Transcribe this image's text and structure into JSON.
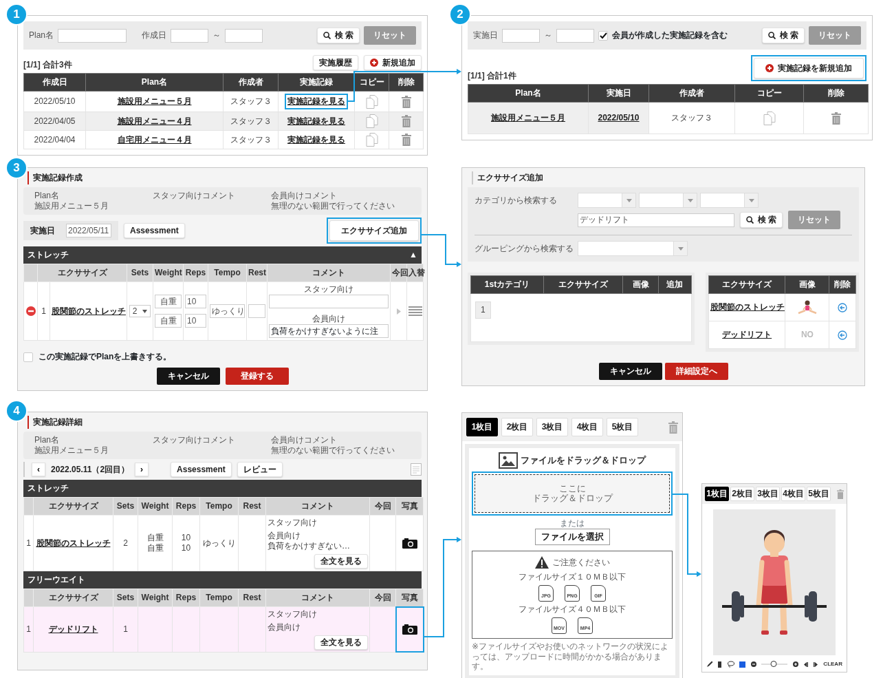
{
  "markers": [
    {
      "label": "1"
    },
    {
      "label": "2"
    },
    {
      "label": "3"
    },
    {
      "label": "4"
    }
  ],
  "plan_list": {
    "plan_label": "Plan名",
    "date_label": "作成日",
    "range_sep": "～",
    "search_button": "検 索",
    "reset_button": "リセット",
    "history_button": "実施履歴",
    "add_button": "新規追加",
    "count": "[1/1] 合計3件",
    "columns": [
      "作成日",
      "Plan名",
      "作成者",
      "実施記録",
      "コピー",
      "削除"
    ],
    "rows": [
      {
        "cells": [
          "2022/05/10",
          "施設用メニュー５月",
          "スタッフ３",
          "実施記録を見る"
        ],
        "highlighted": true
      },
      {
        "cells": [
          "2022/04/05",
          "施設用メニュー４月",
          "スタッフ３",
          "実施記録を見る"
        ],
        "highlighted": false
      },
      {
        "cells": [
          "2022/04/04",
          "自宅用メニュー４月",
          "スタッフ３",
          "実施記録を見る"
        ],
        "highlighted": false
      }
    ]
  },
  "record_list": {
    "date_label": "実施日",
    "range_sep": "～",
    "include_member": {
      "checked": true,
      "label": "会員が作成した実施記録を含む"
    },
    "search_button": "検 索",
    "reset_button": "リセット",
    "add_button": {
      "label": "実施記録を新規追加",
      "highlighted": true
    },
    "count": "[1/1] 合計1件",
    "columns": [
      "Plan名",
      "実施日",
      "作成者",
      "コピー",
      "削除"
    ],
    "rows": [
      {
        "cells": [
          "施設用メニュー５月",
          "2022/05/10",
          "スタッフ３"
        ]
      }
    ]
  },
  "record_create": {
    "title": "実施記録作成",
    "info": [
      {
        "label": "Plan名",
        "value": "施設用メニュー５月"
      },
      {
        "label": "スタッフ向けコメント"
      },
      {
        "label": "会員向けコメント",
        "value": "無理のない範囲で行ってください"
      }
    ],
    "date_label": "実施日",
    "date_value": "2022/05/11",
    "assessment_button": "Assessment",
    "add_exercise_button": {
      "label": "エクササイズ追加",
      "highlighted": true
    },
    "section": {
      "title": "ストレッチ",
      "toggle": "▲",
      "columns": [
        "エクササイズ",
        "Sets",
        "Weight",
        "Reps",
        "Tempo",
        "Rest",
        "コメント",
        "今回",
        "入替"
      ],
      "rows": [
        {
          "no": "1",
          "exercise": "股関節のストレッチ",
          "sets": "2",
          "weights": [
            "自重",
            "自重"
          ],
          "reps": [
            "10",
            "10"
          ],
          "tempo": "ゆっくり",
          "staff_label": "スタッフ向け",
          "member_label": "会員向け",
          "member_value": "負荷をかけすぎないように注"
        }
      ]
    },
    "overwrite": {
      "checked": false,
      "label": "この実施記録でPlanを上書きする。"
    },
    "cancel_button": "キャンセル",
    "submit_button": "登録する"
  },
  "exercise_add": {
    "title": "エクササイズ追加",
    "category_label": "カテゴリから検索する",
    "keyword": "デッドリフト",
    "search_button": "検 索",
    "reset_button": "リセット",
    "grouping_label": "グルーピングから検索する",
    "result_columns": [
      "1stカテゴリ",
      "エクササイズ",
      "画像",
      "追加"
    ],
    "page": "1",
    "selected_columns": [
      "エクササイズ",
      "画像",
      "削除"
    ],
    "selected_rows": [
      {
        "name": "股関節のストレッチ",
        "kind": "illustration"
      },
      {
        "name": "デッドリフト",
        "kind": "no_image",
        "no_image_text": "NO"
      }
    ],
    "cancel_button": "キャンセル",
    "next_button": "詳細設定へ"
  },
  "record_detail": {
    "title": "実施記録詳細",
    "info": [
      {
        "label": "Plan名",
        "value": "施設用メニュー５月"
      },
      {
        "label": "スタッフ向けコメント"
      },
      {
        "label": "会員向けコメント",
        "value": "無理のない範囲で行ってください"
      }
    ],
    "nav": {
      "prev": "‹",
      "date": "2022.05.11（2回目）",
      "next": "›"
    },
    "assessment_button": "Assessment",
    "review_button": "レビュー",
    "sections": [
      {
        "title": "ストレッチ",
        "columns": [
          "エクササイズ",
          "Sets",
          "Weight",
          "Reps",
          "Tempo",
          "Rest",
          "コメント",
          "今回",
          "写真"
        ],
        "rows": [
          {
            "no": "1",
            "exercise": "股関節のストレッチ",
            "sets": "2",
            "weights": [
              "自重",
              "自重"
            ],
            "reps": [
              "10",
              "10"
            ],
            "tempo": "ゆっくり",
            "staff_label": "スタッフ向け",
            "member_label": "会員向け",
            "member_text": "負荷をかけすぎない…",
            "full_button": "全文を見る",
            "highlighted": false
          }
        ]
      },
      {
        "title": "フリーウエイト",
        "columns": [
          "エクササイズ",
          "Sets",
          "Weight",
          "Reps",
          "Tempo",
          "Rest",
          "コメント",
          "今回",
          "写真"
        ],
        "rows": [
          {
            "no": "1",
            "exercise": "デッドリフト",
            "sets": "1",
            "weights": [],
            "reps": [],
            "staff_label": "スタッフ向け",
            "member_label": "会員向け",
            "full_button": "全文を見る",
            "highlighted": true
          }
        ]
      }
    ]
  },
  "photo_upload": {
    "tabs": [
      {
        "label": "1枚目",
        "selected": true
      },
      {
        "label": "2枚目",
        "selected": false
      },
      {
        "label": "3枚目",
        "selected": false
      },
      {
        "label": "4枚目",
        "selected": false
      },
      {
        "label": "5枚目",
        "selected": false
      }
    ],
    "heading": "ファイルをドラッグ＆ドロップ",
    "dropzone": {
      "lines": [
        "ここに",
        "ドラッグ＆ドロップ"
      ],
      "highlighted": true
    },
    "or": "または",
    "choose_button": "ファイルを選択",
    "notice": {
      "title": "ご注意ください",
      "groups": [
        {
          "limit": "ファイルサイズ１０ＭＢ以下",
          "types": [
            "JPG",
            "PNG",
            "GIF"
          ]
        },
        {
          "limit": "ファイルサイズ４０ＭＢ以下",
          "types": [
            "MOV",
            "MP4"
          ]
        }
      ]
    },
    "footnote": "※ファイルサイズやお使いのネットワークの状況によっては、アップロードに時間がかかる場合があります。"
  },
  "photo_viewer": {
    "tabs": [
      {
        "label": "1枚目",
        "selected": true
      },
      {
        "label": "2枚目",
        "selected": false
      },
      {
        "label": "3枚目",
        "selected": false
      },
      {
        "label": "4枚目",
        "selected": false
      },
      {
        "label": "5枚目",
        "selected": false
      }
    ],
    "color": "#1a5ee0",
    "size_slider": {
      "level": 0.45
    },
    "clear_button": "CLEAR"
  }
}
